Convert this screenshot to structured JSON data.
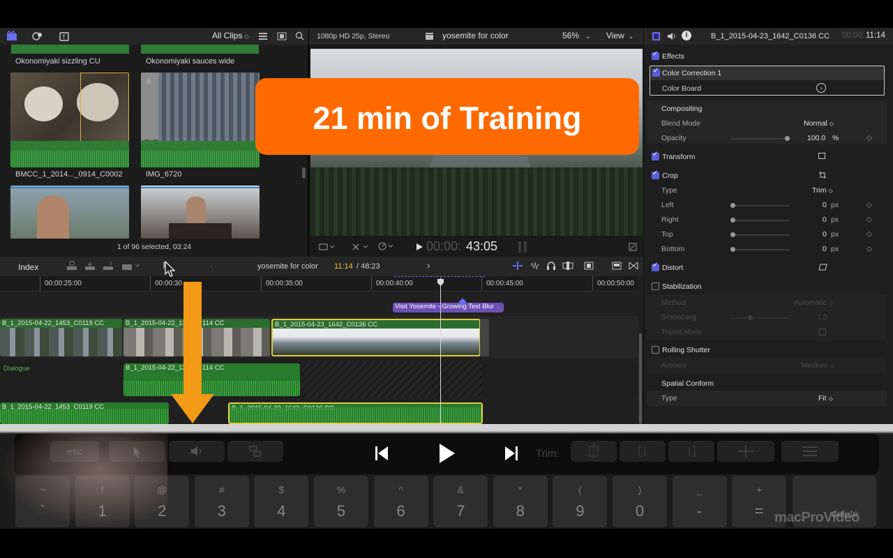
{
  "browser": {
    "all_clips_label": "All Clips",
    "clips": [
      {
        "name": "Okonomiyaki sizzling CU"
      },
      {
        "name": "Okonomiyaki sauces wide"
      },
      {
        "name": "BMCC_1_2014..._0914_C0002"
      },
      {
        "name": "IMG_6720"
      }
    ],
    "status": "1 of 96 selected, 03:24"
  },
  "viewer": {
    "format": "1080p HD 25p, Stereo",
    "title": "yosemite for color",
    "zoom": "56%",
    "view_label": "View",
    "timecode_dim": "00:00:",
    "timecode": "43:05"
  },
  "banner": {
    "text": "21 min of Training",
    "color": "#ff6a00"
  },
  "inspector": {
    "clip_name": "B_1_2015-04-23_1642_C0136 CC",
    "timecode_dim": "00:00:",
    "timecode": "11:14",
    "effects_label": "Effects",
    "color_correction": "Color Correction 1",
    "color_board": "Color Board",
    "compositing": "Compositing",
    "blend_mode_label": "Blend Mode",
    "blend_mode_value": "Normal",
    "opacity_label": "Opacity",
    "opacity_value": "100.0",
    "opacity_unit": "%",
    "transform": "Transform",
    "crop": "Crop",
    "crop_type_label": "Type",
    "crop_type_value": "Trim",
    "left_label": "Left",
    "right_label": "Right",
    "top_label": "Top",
    "bottom_label": "Bottom",
    "crop_value": "0",
    "px": "px",
    "distort": "Distort",
    "stabilization": "Stabilization",
    "method_label": "Method",
    "method_value": "Automatic",
    "smoothing_label": "Smoothing",
    "smoothing_value": "1.0",
    "tripod_label": "Tripod Mode",
    "rolling_shutter": "Rolling Shutter",
    "amount_label": "Amount",
    "amount_value": "Medium",
    "spatial_conform": "Spatial Conform",
    "conform_type_label": "Type",
    "conform_type_value": "Fit"
  },
  "timeline": {
    "index_label": "Index",
    "project_name": "yosemite for color",
    "position": "11:14",
    "duration": "/ 48:23",
    "ruler": [
      "00:00:25:00",
      "00:00:30",
      "00:00:35:00",
      "00:00:40:00",
      "00:00:45:00",
      "00:00:50:00"
    ],
    "title_clip": "Visit Yosemite - Growing Text Blur",
    "video_clips": [
      "B_1_2015-04-22_1453_C0119 CC",
      "B_1_2015-04-22_13",
      "114 CC",
      "B_1_2015-04-23_1642_C0136 CC"
    ],
    "dialogue_label": "Dialogue",
    "dialogue_clip": "B_1_2015-04-22_13",
    "dialogue_clip_tail": "114 CC",
    "audio_clips": [
      "B_1_2015-04-22_1453_C0119 CC",
      "B_1_2015-04-23_1642_C0136 CC"
    ]
  },
  "touchbar": {
    "esc": "esc",
    "trim_label": "Trim:",
    "delete_label": "delete",
    "number_keys": [
      {
        "top": "~",
        "bottom": "`"
      },
      {
        "top": "!",
        "bottom": "1"
      },
      {
        "top": "@",
        "bottom": "2"
      },
      {
        "top": "#",
        "bottom": "3"
      },
      {
        "top": "$",
        "bottom": "4"
      },
      {
        "top": "%",
        "bottom": "5"
      },
      {
        "top": "^",
        "bottom": "6"
      },
      {
        "top": "&",
        "bottom": "7"
      },
      {
        "top": "*",
        "bottom": "8"
      },
      {
        "top": "(",
        "bottom": "9"
      },
      {
        "top": ")",
        "bottom": "0"
      },
      {
        "top": "_",
        "bottom": "-"
      },
      {
        "top": "+",
        "bottom": "="
      }
    ]
  },
  "watermark": "macProVideo"
}
